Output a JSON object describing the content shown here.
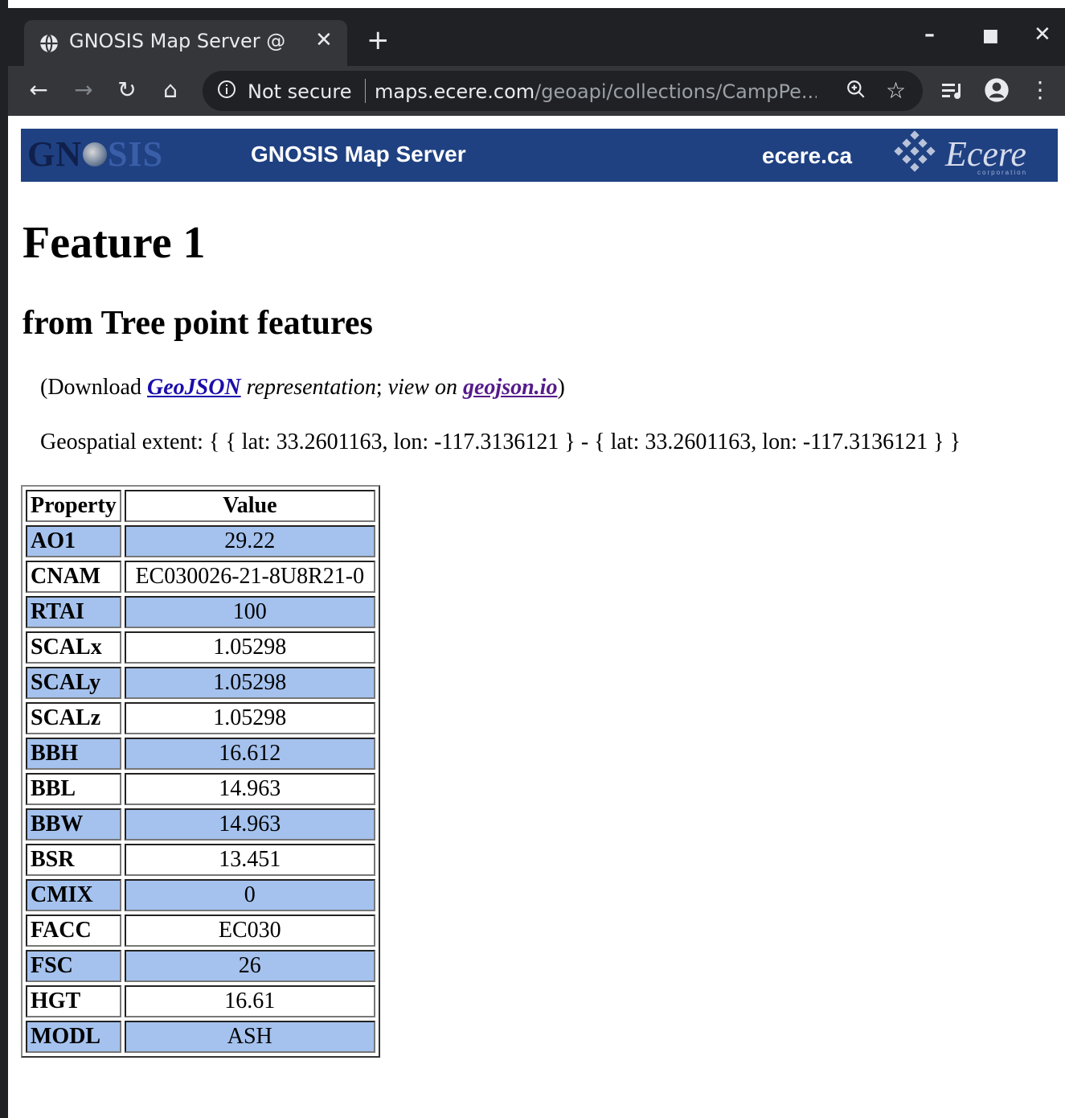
{
  "browser": {
    "tab_title": "GNOSIS Map Server @",
    "security_label": "Not secure",
    "url_host": "maps.ecere.com",
    "url_path": "/geoapi/collections/CampPe..."
  },
  "banner": {
    "logo_text_left": "GN",
    "logo_text_right": "SIS",
    "title": "GNOSIS Map Server",
    "link": "ecere.ca",
    "ecere_logo": "Ecere",
    "ecere_sub": "corporation"
  },
  "page": {
    "title": "Feature 1",
    "subtitle": "from Tree point features",
    "download_prefix": "(Download ",
    "geojson_link": "GeoJSON",
    "download_middle": " representation",
    "download_sep": "; ",
    "view_on": "view on ",
    "geojsonio_link": "geojson.io",
    "download_suffix": ")",
    "extent": "Geospatial extent: { { lat: 33.2601163, lon: -117.3136121 } - { lat: 33.2601163, lon: -117.3136121 } }"
  },
  "table": {
    "headers": [
      "Property",
      "Value"
    ],
    "rows": [
      {
        "key": "AO1",
        "value": "29.22"
      },
      {
        "key": "CNAM",
        "value": "EC030026-21-8U8R21-0"
      },
      {
        "key": "RTAI",
        "value": "100"
      },
      {
        "key": "SCALx",
        "value": "1.05298"
      },
      {
        "key": "SCALy",
        "value": "1.05298"
      },
      {
        "key": "SCALz",
        "value": "1.05298"
      },
      {
        "key": "BBH",
        "value": "16.612"
      },
      {
        "key": "BBL",
        "value": "14.963"
      },
      {
        "key": "BBW",
        "value": "14.963"
      },
      {
        "key": "BSR",
        "value": "13.451"
      },
      {
        "key": "CMIX",
        "value": "0"
      },
      {
        "key": "FACC",
        "value": "EC030"
      },
      {
        "key": "FSC",
        "value": "26"
      },
      {
        "key": "HGT",
        "value": "16.61"
      },
      {
        "key": "MODL",
        "value": "ASH"
      }
    ]
  },
  "colors": {
    "banner_bg": "#1f4182",
    "row_alt": "#a5c2ee",
    "chrome_dark": "#202124",
    "chrome_toolbar": "#35363a"
  }
}
